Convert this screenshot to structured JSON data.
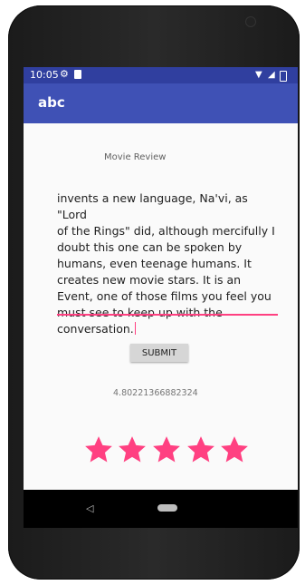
{
  "status_bar": {
    "time": "10:05"
  },
  "toolbar": {
    "title": "abc"
  },
  "review": {
    "label": "Movie Review",
    "lines": [
      "invents a new language, Na'vi, as \"Lord",
      "of the Rings\" did, although mercifully I",
      "doubt this one can be spoken by",
      "humans, even teenage humans. It",
      "creates new movie stars. It is an",
      "Event, one of those films you feel you",
      "must see to keep up with the",
      "conversation."
    ]
  },
  "submit_label": "SUBMIT",
  "score_text": "4.80221366882324",
  "rating": {
    "value": 5,
    "max": 5,
    "color": "#ff4081"
  },
  "icons": [
    "gear-icon",
    "sd-card-icon",
    "wifi-icon",
    "signal-icon",
    "battery-icon",
    "back-icon",
    "home-icon"
  ]
}
